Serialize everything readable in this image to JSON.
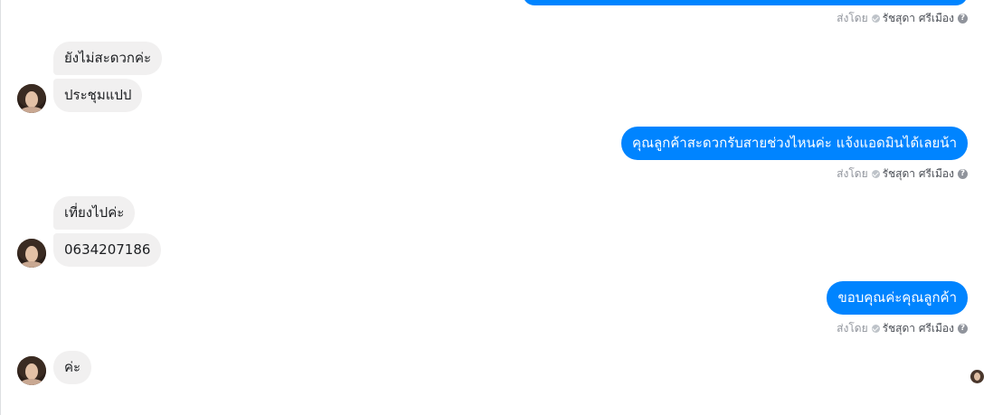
{
  "conversation": {
    "sent_by_prefix": "ส่งโดย",
    "agent_name": "รัชสุดา ศรีเมือง",
    "help_glyph": "?",
    "incoming": [
      {
        "text": "ยังไม่สะดวกค่ะ"
      },
      {
        "text": "ประชุมแปป"
      },
      {
        "text": "เที่ยงไปค่ะ"
      },
      {
        "text": "0634207186"
      },
      {
        "text": "ค่ะ"
      }
    ],
    "outgoing": [
      {
        "text": "คุณลูกค้าสะดวกรับสายช่วงไหนค่ะ  แจ้งแอดมินได้เลยน้า"
      },
      {
        "text": "ขอบคุณค่ะคุณลูกค้า"
      }
    ]
  },
  "colors": {
    "outgoing_bubble": "#0084ff",
    "incoming_bubble": "#f1f0f0",
    "meta_text": "#90949c"
  }
}
